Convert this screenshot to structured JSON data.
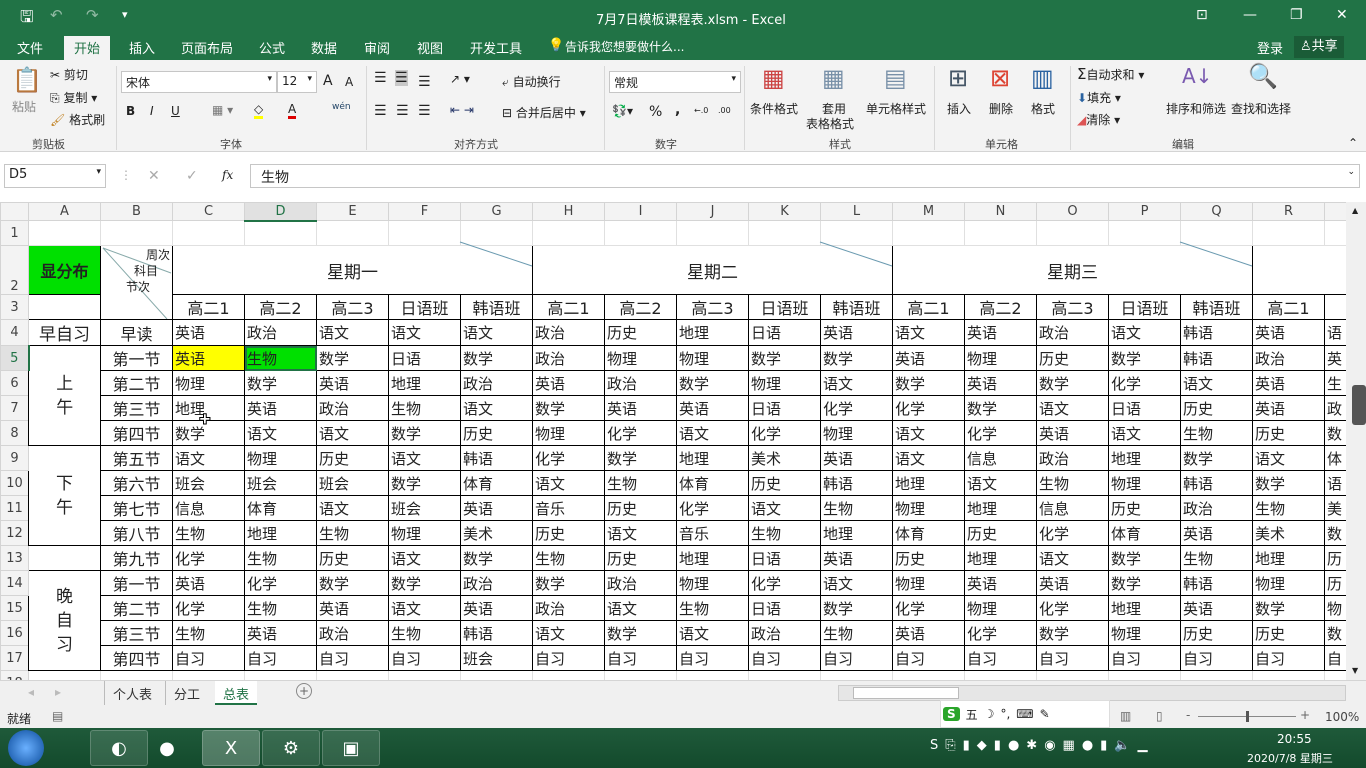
{
  "window": {
    "title": "7月7日模板课程表.xlsm - Excel",
    "controls": [
      "⊡",
      "—",
      "❐",
      "✕"
    ]
  },
  "qat": {
    "save": "🖫",
    "undo": "↶",
    "redo": "↷",
    "more": "▾"
  },
  "menu": {
    "items": [
      "文件",
      "开始",
      "插入",
      "页面布局",
      "公式",
      "数据",
      "审阅",
      "视图",
      "开发工具"
    ],
    "active": "开始",
    "tell_me": "告诉我您想要做什么...",
    "login": "登录",
    "share": "共享"
  },
  "ribbon": {
    "clipboard": {
      "paste": "粘贴",
      "cut": "剪切",
      "copy": "复制",
      "format_painter": "格式刷",
      "label": "剪贴板"
    },
    "font": {
      "name": "宋体",
      "size": "12",
      "bold": "B",
      "italic": "I",
      "underline": "U",
      "label": "字体",
      "grow": "A",
      "shrink": "A",
      "phonetic": "wén"
    },
    "alignment": {
      "wrap": "自动换行",
      "merge": "合并后居中",
      "label": "对齐方式"
    },
    "number": {
      "format": "常规",
      "percent": "%",
      "comma": ",",
      "inc": "←.0",
      "dec": ".00",
      "label": "数字"
    },
    "styles": {
      "conditional": "条件格式",
      "table_l1": "套用",
      "table_l2": "表格格式",
      "cell_styles": "单元格样式",
      "label": "样式"
    },
    "cells": {
      "insert": "插入",
      "delete": "删除",
      "format": "格式",
      "label": "单元格"
    },
    "editing": {
      "autosum": "自动求和",
      "fill": "填充",
      "clear": "清除",
      "sort": "排序和筛选",
      "find": "查找和选择",
      "label": "编辑"
    }
  },
  "formula_bar": {
    "name_box": "D5",
    "cancel": "✕",
    "enter": "✓",
    "fx": "fx",
    "value": "生物"
  },
  "sheet": {
    "columns": [
      "A",
      "B",
      "C",
      "D",
      "E",
      "F",
      "G",
      "H",
      "I",
      "J",
      "K",
      "L",
      "M",
      "N",
      "O",
      "P",
      "Q",
      "R",
      "S"
    ],
    "selected_cell": "D5",
    "a2": "显分布",
    "a2_color": "#00e000",
    "diag": {
      "top": "周次",
      "mid": "科目",
      "bottom": "节次"
    },
    "days": [
      "星期一",
      "星期二",
      "星期三"
    ],
    "classes": [
      "高二1",
      "高二2",
      "高二3",
      "日语班",
      "韩语班",
      "高二1",
      "高二2",
      "高二3",
      "日语班",
      "韩语班",
      "高二1",
      "高二2",
      "高二3",
      "日语班",
      "韩语班",
      "高二1",
      "高"
    ],
    "blocks": [
      {
        "label": "早自习",
        "start": 4,
        "span": 1
      },
      {
        "label": "上午",
        "start": 5,
        "span": 4
      },
      {
        "label": "下午",
        "start": 9,
        "span": 4
      },
      {
        "label": "",
        "start": 13,
        "span": 1
      },
      {
        "label": "晚自习",
        "start": 14,
        "span": 4
      }
    ],
    "rows": [
      {
        "n": 4,
        "period": "早读",
        "cells": [
          "英语",
          "政治",
          "语文",
          "语文",
          "语文",
          "政治",
          "历史",
          "地理",
          "日语",
          "英语",
          "语文",
          "英语",
          "政治",
          "语文",
          "韩语",
          "英语",
          "语"
        ]
      },
      {
        "n": 5,
        "period": "第一节",
        "cells": [
          "英语",
          "生物",
          "数学",
          "日语",
          "数学",
          "政治",
          "物理",
          "物理",
          "数学",
          "数学",
          "英语",
          "物理",
          "历史",
          "数学",
          "韩语",
          "政治",
          "英"
        ]
      },
      {
        "n": 6,
        "period": "第二节",
        "cells": [
          "物理",
          "数学",
          "英语",
          "地理",
          "政治",
          "英语",
          "政治",
          "数学",
          "物理",
          "语文",
          "数学",
          "英语",
          "数学",
          "化学",
          "语文",
          "英语",
          "生"
        ]
      },
      {
        "n": 7,
        "period": "第三节",
        "cells": [
          "地理",
          "英语",
          "政治",
          "生物",
          "语文",
          "数学",
          "英语",
          "英语",
          "日语",
          "化学",
          "化学",
          "数学",
          "语文",
          "日语",
          "历史",
          "英语",
          "政"
        ]
      },
      {
        "n": 8,
        "period": "第四节",
        "cells": [
          "数学",
          "语文",
          "语文",
          "数学",
          "历史",
          "物理",
          "化学",
          "语文",
          "化学",
          "物理",
          "语文",
          "化学",
          "英语",
          "语文",
          "生物",
          "历史",
          "数"
        ]
      },
      {
        "n": 9,
        "period": "第五节",
        "cells": [
          "语文",
          "物理",
          "历史",
          "语文",
          "韩语",
          "化学",
          "数学",
          "地理",
          "美术",
          "英语",
          "语文",
          "信息",
          "政治",
          "地理",
          "数学",
          "语文",
          "体"
        ]
      },
      {
        "n": 10,
        "period": "第六节",
        "cells": [
          "班会",
          "班会",
          "班会",
          "数学",
          "体育",
          "语文",
          "生物",
          "体育",
          "历史",
          "韩语",
          "地理",
          "语文",
          "生物",
          "物理",
          "韩语",
          "数学",
          "语"
        ]
      },
      {
        "n": 11,
        "period": "第七节",
        "cells": [
          "信息",
          "体育",
          "语文",
          "班会",
          "英语",
          "音乐",
          "历史",
          "化学",
          "语文",
          "生物",
          "物理",
          "地理",
          "信息",
          "历史",
          "政治",
          "生物",
          "美"
        ]
      },
      {
        "n": 12,
        "period": "第八节",
        "cells": [
          "生物",
          "地理",
          "生物",
          "物理",
          "美术",
          "历史",
          "语文",
          "音乐",
          "生物",
          "地理",
          "体育",
          "历史",
          "化学",
          "体育",
          "英语",
          "美术",
          "数"
        ]
      },
      {
        "n": 13,
        "period": "第九节",
        "cells": [
          "化学",
          "生物",
          "历史",
          "语文",
          "数学",
          "生物",
          "历史",
          "地理",
          "日语",
          "英语",
          "历史",
          "地理",
          "语文",
          "数学",
          "生物",
          "地理",
          "历"
        ]
      },
      {
        "n": 14,
        "period": "第一节",
        "cells": [
          "英语",
          "化学",
          "数学",
          "数学",
          "政治",
          "数学",
          "政治",
          "物理",
          "化学",
          "语文",
          "物理",
          "英语",
          "英语",
          "数学",
          "韩语",
          "物理",
          "历"
        ]
      },
      {
        "n": 15,
        "period": "第二节",
        "cells": [
          "化学",
          "生物",
          "英语",
          "语文",
          "英语",
          "政治",
          "语文",
          "生物",
          "日语",
          "数学",
          "化学",
          "物理",
          "化学",
          "地理",
          "英语",
          "数学",
          "物"
        ]
      },
      {
        "n": 16,
        "period": "第三节",
        "cells": [
          "生物",
          "英语",
          "政治",
          "生物",
          "韩语",
          "语文",
          "数学",
          "语文",
          "政治",
          "生物",
          "英语",
          "化学",
          "数学",
          "物理",
          "历史",
          "历史",
          "数"
        ]
      },
      {
        "n": 17,
        "period": "第四节",
        "cells": [
          "自习",
          "自习",
          "自习",
          "自习",
          "班会",
          "自习",
          "自习",
          "自习",
          "自习",
          "自习",
          "自习",
          "自习",
          "自习",
          "自习",
          "自习",
          "自习",
          "自"
        ]
      }
    ],
    "highlights": {
      "C5": "#ffff00",
      "D5": "#00e000"
    }
  },
  "sheet_tabs": {
    "items": [
      "个人表",
      "分工",
      "总表"
    ],
    "active": "总表",
    "add": "+"
  },
  "status": {
    "ready": "就绪",
    "zoom": "100%",
    "ime": [
      "五",
      "☽",
      "°,",
      "⌨",
      "✎"
    ]
  },
  "taskbar": {
    "time": "20:55",
    "date": "2020/7/8 星期三"
  }
}
